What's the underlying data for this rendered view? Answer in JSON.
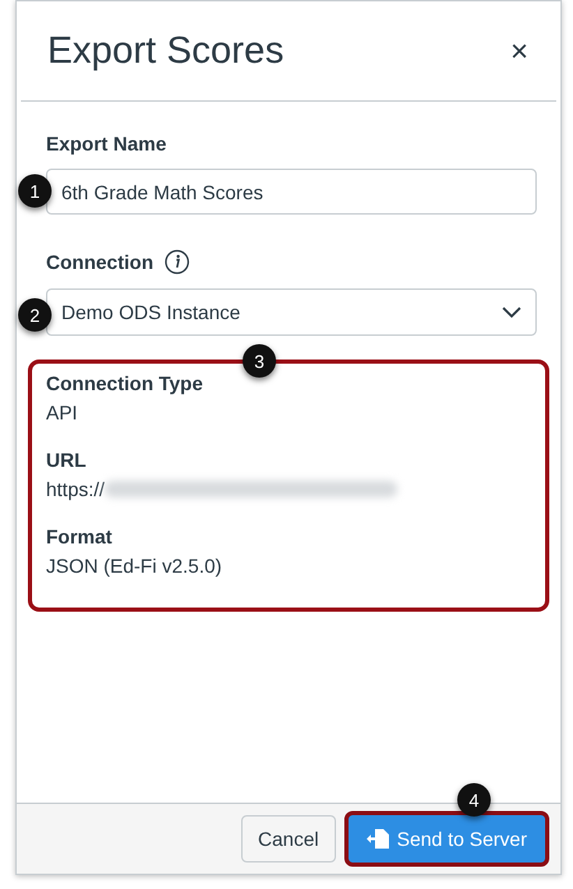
{
  "dialog": {
    "title": "Export Scores",
    "close": "×"
  },
  "fields": [
    {
      "label": "Export Name",
      "value": "6th Grade Math Scores",
      "kind": "text",
      "callout": "1"
    },
    {
      "label": "Connection",
      "value": "Demo ODS Instance",
      "kind": "select",
      "callout": "2"
    }
  ],
  "details": {
    "callout": "3",
    "items": [
      {
        "label": "Connection Type",
        "value": "API",
        "redacted": false
      },
      {
        "label": "URL",
        "value": "https://",
        "redacted": true
      },
      {
        "label": "Format",
        "value": "JSON (Ed-Fi v2.5.0)",
        "redacted": false
      }
    ]
  },
  "footer": {
    "cancel": "Cancel",
    "send": "Send to Server",
    "callout": "4"
  }
}
